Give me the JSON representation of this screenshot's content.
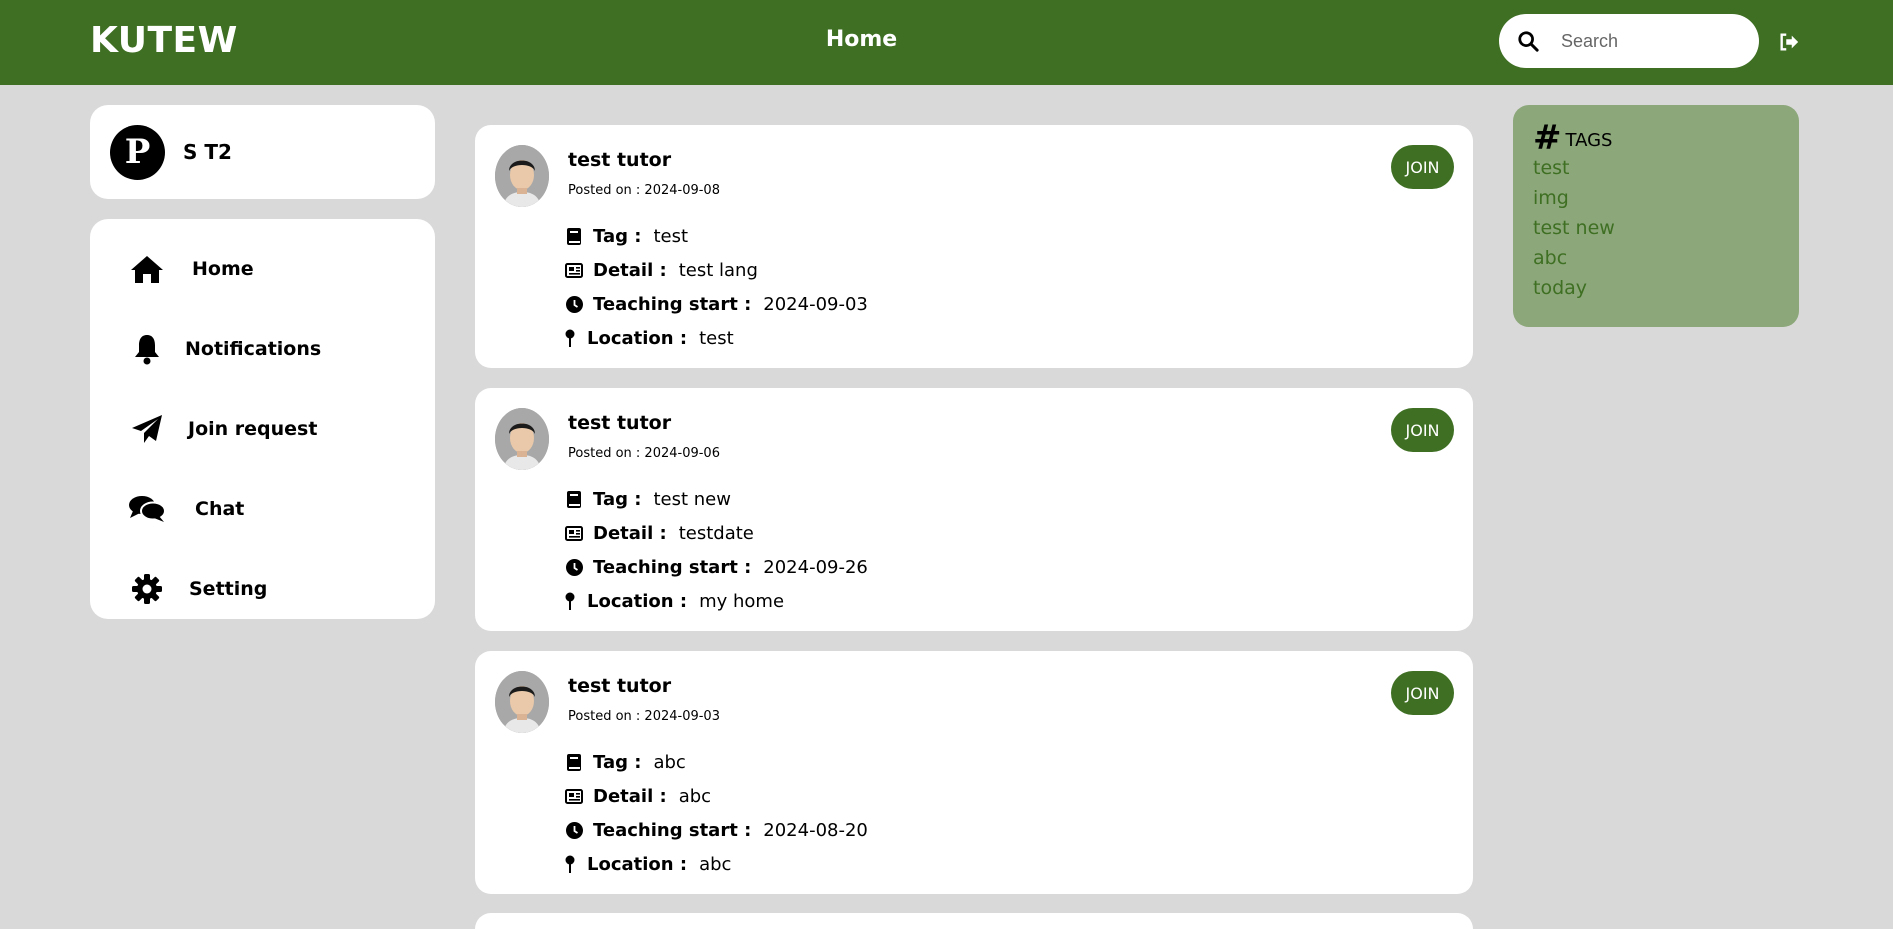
{
  "header": {
    "brand": "KUTEW",
    "title": "Home",
    "search_placeholder": "Search"
  },
  "profile": {
    "initial": "P",
    "name": "S T2"
  },
  "nav": {
    "items": [
      {
        "label": "Home",
        "icon": "home-icon"
      },
      {
        "label": "Notifications",
        "icon": "bell-icon"
      },
      {
        "label": "Join request",
        "icon": "paper-plane-icon"
      },
      {
        "label": "Chat",
        "icon": "chat-icon"
      },
      {
        "label": "Setting",
        "icon": "gear-icon"
      }
    ]
  },
  "field_labels": {
    "tag": "Tag :",
    "detail": "Detail :",
    "teaching_start": "Teaching start :",
    "location": "Location :"
  },
  "posts": [
    {
      "author": "test tutor",
      "posted": "Posted on : 2024-09-08",
      "join_label": "JOIN",
      "tag": "test",
      "detail": "test lang",
      "teaching_start": "2024-09-03",
      "location": "test"
    },
    {
      "author": "test tutor",
      "posted": "Posted on : 2024-09-06",
      "join_label": "JOIN",
      "tag": "test new",
      "detail": "testdate",
      "teaching_start": "2024-09-26",
      "location": "my home"
    },
    {
      "author": "test tutor",
      "posted": "Posted on : 2024-09-03",
      "join_label": "JOIN",
      "tag": "abc",
      "detail": "abc",
      "teaching_start": "2024-08-20",
      "location": "abc"
    }
  ],
  "tags": {
    "title": "TAGS",
    "hash": "#",
    "items": [
      "test",
      "img",
      "test new",
      "abc",
      "today"
    ]
  },
  "colors": {
    "brand_green": "#3e6f22",
    "tags_panel": "#8ca77a",
    "page_bg": "#d9d9d9"
  }
}
